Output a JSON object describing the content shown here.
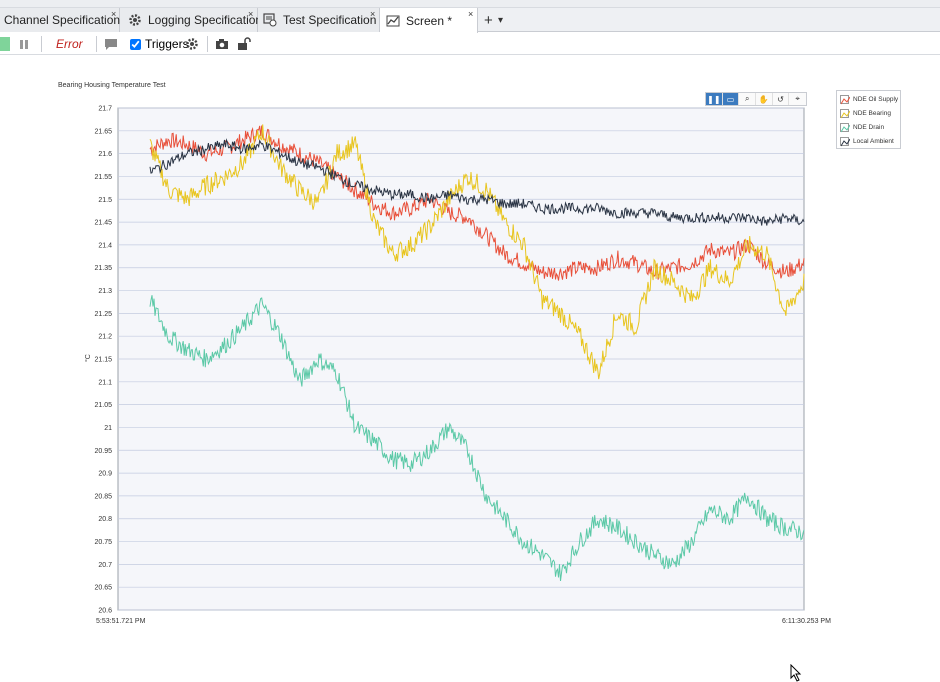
{
  "tabs": [
    {
      "label": "Channel Specification *",
      "icon": "none",
      "close": "×"
    },
    {
      "label": "Logging Specification",
      "icon": "gear-icon",
      "close": "×"
    },
    {
      "label": "Test Specification *",
      "icon": "test-icon",
      "close": "×"
    },
    {
      "label": "Screen *",
      "icon": "chart-icon",
      "close": "×",
      "active": true
    }
  ],
  "add_tab": "+",
  "add_tab_menu": "▾",
  "toolbar": {
    "error_label": "Error",
    "triggers_label": "Triggers",
    "triggers_checked": true
  },
  "chart_tools": [
    "pause",
    "select",
    "zoom",
    "pan",
    "reset",
    "cursor"
  ],
  "chart_data": {
    "type": "line",
    "title": "Bearing Housing Temperature Test",
    "ylabel": "°C",
    "x_start_label": "5:53:51.721 PM",
    "x_end_label": "6:11:30.253 PM",
    "ylim": [
      20.6,
      21.7
    ],
    "y_ticks": [
      "21.7",
      "21.65",
      "21.6",
      "21.55",
      "21.5",
      "21.45",
      "21.4",
      "21.35",
      "21.3",
      "21.25",
      "21.2",
      "21.15",
      "21.1",
      "21.05",
      "21",
      "20.95",
      "20.9",
      "20.85",
      "20.8",
      "20.75",
      "20.7",
      "20.65",
      "20.6"
    ],
    "grid": true,
    "legend_position": "right",
    "series": [
      {
        "name": "NDE Oil Supply",
        "color": "#e8503a",
        "values": [
          21.61,
          21.63,
          21.62,
          21.6,
          21.61,
          21.63,
          21.65,
          21.62,
          21.6,
          21.58,
          21.55,
          21.52,
          21.49,
          21.47,
          21.48,
          21.5,
          21.47,
          21.46,
          21.42,
          21.38,
          21.36,
          21.34,
          21.34,
          21.35,
          21.35,
          21.37,
          21.36,
          21.34,
          21.35,
          21.36,
          21.39,
          21.38,
          21.4,
          21.36,
          21.34,
          21.36
        ]
      },
      {
        "name": "NDE Bearing",
        "color": "#e8c520",
        "values": [
          21.62,
          21.52,
          21.5,
          21.53,
          21.55,
          21.58,
          21.65,
          21.57,
          21.52,
          21.49,
          21.6,
          21.62,
          21.45,
          21.38,
          21.4,
          21.44,
          21.5,
          21.55,
          21.52,
          21.45,
          21.4,
          21.28,
          21.25,
          21.2,
          21.12,
          21.25,
          21.22,
          21.35,
          21.32,
          21.28,
          21.35,
          21.32,
          21.4,
          21.38,
          21.25,
          21.32
        ]
      },
      {
        "name": "NDE Drain",
        "color": "#5cc9a7",
        "values": [
          21.28,
          21.2,
          21.17,
          21.15,
          21.18,
          21.22,
          21.27,
          21.2,
          21.1,
          21.15,
          21.12,
          21.0,
          20.97,
          20.93,
          20.92,
          20.95,
          21.0,
          20.95,
          20.85,
          20.8,
          20.75,
          20.72,
          20.68,
          20.75,
          20.8,
          20.78,
          20.75,
          20.72,
          20.7,
          20.75,
          20.82,
          20.8,
          20.85,
          20.8,
          20.78,
          20.77
        ]
      },
      {
        "name": "Local Ambient",
        "color": "#2b3545",
        "values": [
          21.56,
          21.58,
          21.6,
          21.61,
          21.62,
          21.61,
          21.62,
          21.6,
          21.58,
          21.57,
          21.55,
          21.53,
          21.52,
          21.51,
          21.51,
          21.5,
          21.51,
          21.5,
          21.5,
          21.49,
          21.49,
          21.48,
          21.48,
          21.48,
          21.48,
          21.47,
          21.47,
          21.47,
          21.46,
          21.46,
          21.46,
          21.46,
          21.46,
          21.45,
          21.46,
          21.45
        ]
      }
    ]
  }
}
